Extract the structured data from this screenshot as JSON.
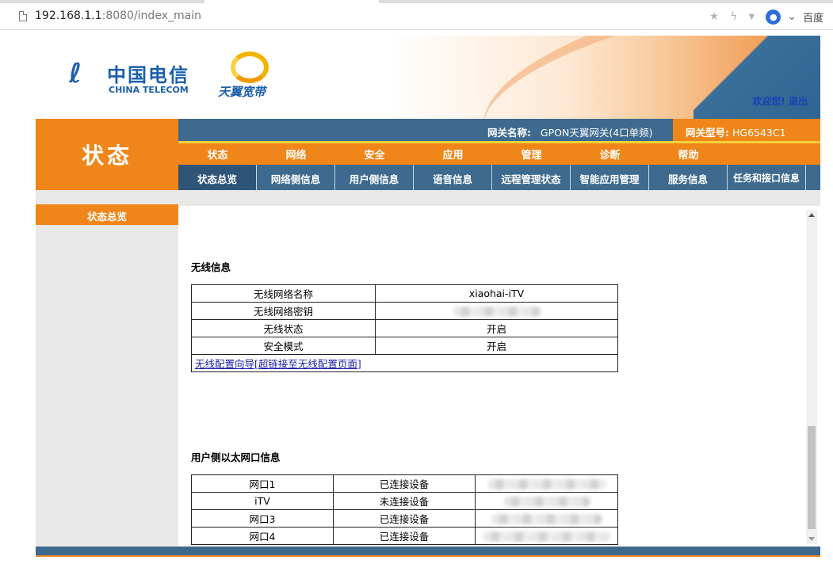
{
  "browser": {
    "url_host": "192.168.1.1",
    "url_rest": ":8080/index_main",
    "search_engine": "百度",
    "icons": [
      "page-icon",
      "star-icon",
      "flash-icon",
      "dropdown-icon",
      "baidu-paw-icon",
      "chevron-down-icon"
    ]
  },
  "header": {
    "logo_cn": "中国电信",
    "logo_en": "CHINA TELECOM",
    "brand": "天翼宽带",
    "welcome_label": "欢迎您!",
    "logout_label": "退出"
  },
  "section_title": "状态",
  "gateway": {
    "name_label": "网关名称:",
    "name_value": "GPON天翼网关(4口单频)",
    "model_label": "网关型号:",
    "model_value": "HG6543C1"
  },
  "main_nav": [
    "状态",
    "网络",
    "安全",
    "应用",
    "管理",
    "诊断",
    "帮助"
  ],
  "sub_nav": [
    "状态总览",
    "网络侧信息",
    "用户侧信息",
    "语音信息",
    "远程管理状态",
    "智能应用管理",
    "服务信息",
    "任务和接口信息"
  ],
  "sidebar": {
    "active_item": "状态总览"
  },
  "wireless": {
    "title": "无线信息",
    "rows": [
      {
        "label": "无线网络名称",
        "value": "xiaohai-iTV"
      },
      {
        "label": "无线网络密钥",
        "value": ""
      },
      {
        "label": "无线状态",
        "value": "开启"
      },
      {
        "label": "安全模式",
        "value": "开启"
      }
    ],
    "wizard_link": "无线配置向导[超链接至无线配置页面]"
  },
  "ethernet": {
    "title": "用户侧以太网口信息",
    "rows": [
      {
        "port": "网口1",
        "status": "已连接设备"
      },
      {
        "port": "iTV",
        "status": "未连接设备"
      },
      {
        "port": "网口3",
        "status": "已连接设备"
      },
      {
        "port": "网口4",
        "status": "已连接设备"
      }
    ]
  },
  "colors": {
    "orange": "#f08519",
    "steel_blue": "#3d6a8e",
    "link_blue": "#1a1aa6"
  }
}
